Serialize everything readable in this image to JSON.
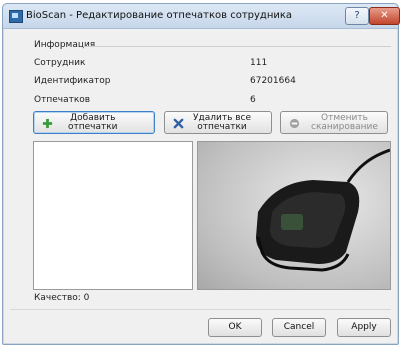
{
  "window": {
    "title": "BioScan - Редактирование отпечатков сотрудника",
    "help_label": "?",
    "close_label": "✕"
  },
  "info": {
    "section_label": "Информация",
    "employee_label": "Сотрудник",
    "employee_value": "111",
    "id_label": "Идентификатор",
    "id_value": "67201664",
    "prints_label": "Отпечатков",
    "prints_value": "6"
  },
  "actions": {
    "add_line1": "Добавить",
    "add_line2": "отпечатки",
    "delete_line1": "Удалить все",
    "delete_line2": "отпечатки",
    "cancel_scan_line1": "Отменить",
    "cancel_scan_line2": "сканирование"
  },
  "quality": {
    "label": "Качество: 0"
  },
  "footer": {
    "ok_label": "OK",
    "cancel_label": "Cancel",
    "apply_label": "Apply"
  },
  "colors": {
    "add_icon": "#3a9a3a",
    "delete_icon": "#2f5fa7",
    "cancel_icon": "#a0a0a0",
    "close_button": "#c2462d"
  }
}
